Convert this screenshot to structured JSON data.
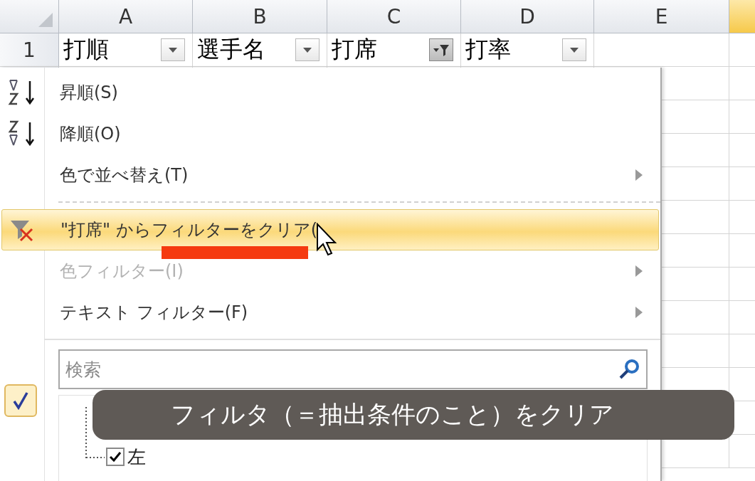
{
  "sheet": {
    "columns": [
      {
        "label": "A"
      },
      {
        "label": "B"
      },
      {
        "label": "C"
      },
      {
        "label": "D"
      },
      {
        "label": "E"
      }
    ],
    "row_header": "1",
    "header_cells": [
      {
        "text": "打順",
        "filtered": false
      },
      {
        "text": "選手名",
        "filtered": false
      },
      {
        "text": "打席",
        "filtered": true
      },
      {
        "text": "打率",
        "filtered": false
      }
    ]
  },
  "menu": {
    "items": [
      {
        "kind": "sort_asc",
        "label": "昇順(S)",
        "disabled": false,
        "selected": false,
        "submenu": false
      },
      {
        "kind": "sort_desc",
        "label": "降順(O)",
        "disabled": false,
        "selected": false,
        "submenu": false
      },
      {
        "kind": "plain",
        "label": "色で並べ替え(T)",
        "disabled": false,
        "selected": false,
        "submenu": true
      },
      {
        "kind": "separator"
      },
      {
        "kind": "clear_filter",
        "label": "\"打席\" からフィルターをクリア(",
        "disabled": false,
        "selected": true,
        "submenu": false
      },
      {
        "kind": "plain",
        "label": "色フィルター(I)",
        "disabled": true,
        "selected": false,
        "submenu": true
      },
      {
        "kind": "plain",
        "label": "テキスト フィルター(F)",
        "disabled": false,
        "selected": false,
        "submenu": true
      },
      {
        "kind": "separator"
      }
    ],
    "search": {
      "placeholder": "検索"
    },
    "values": [
      {
        "label": "左",
        "checked": true
      }
    ]
  },
  "caption": "フィルタ（＝抽出条件のこと）をクリア"
}
